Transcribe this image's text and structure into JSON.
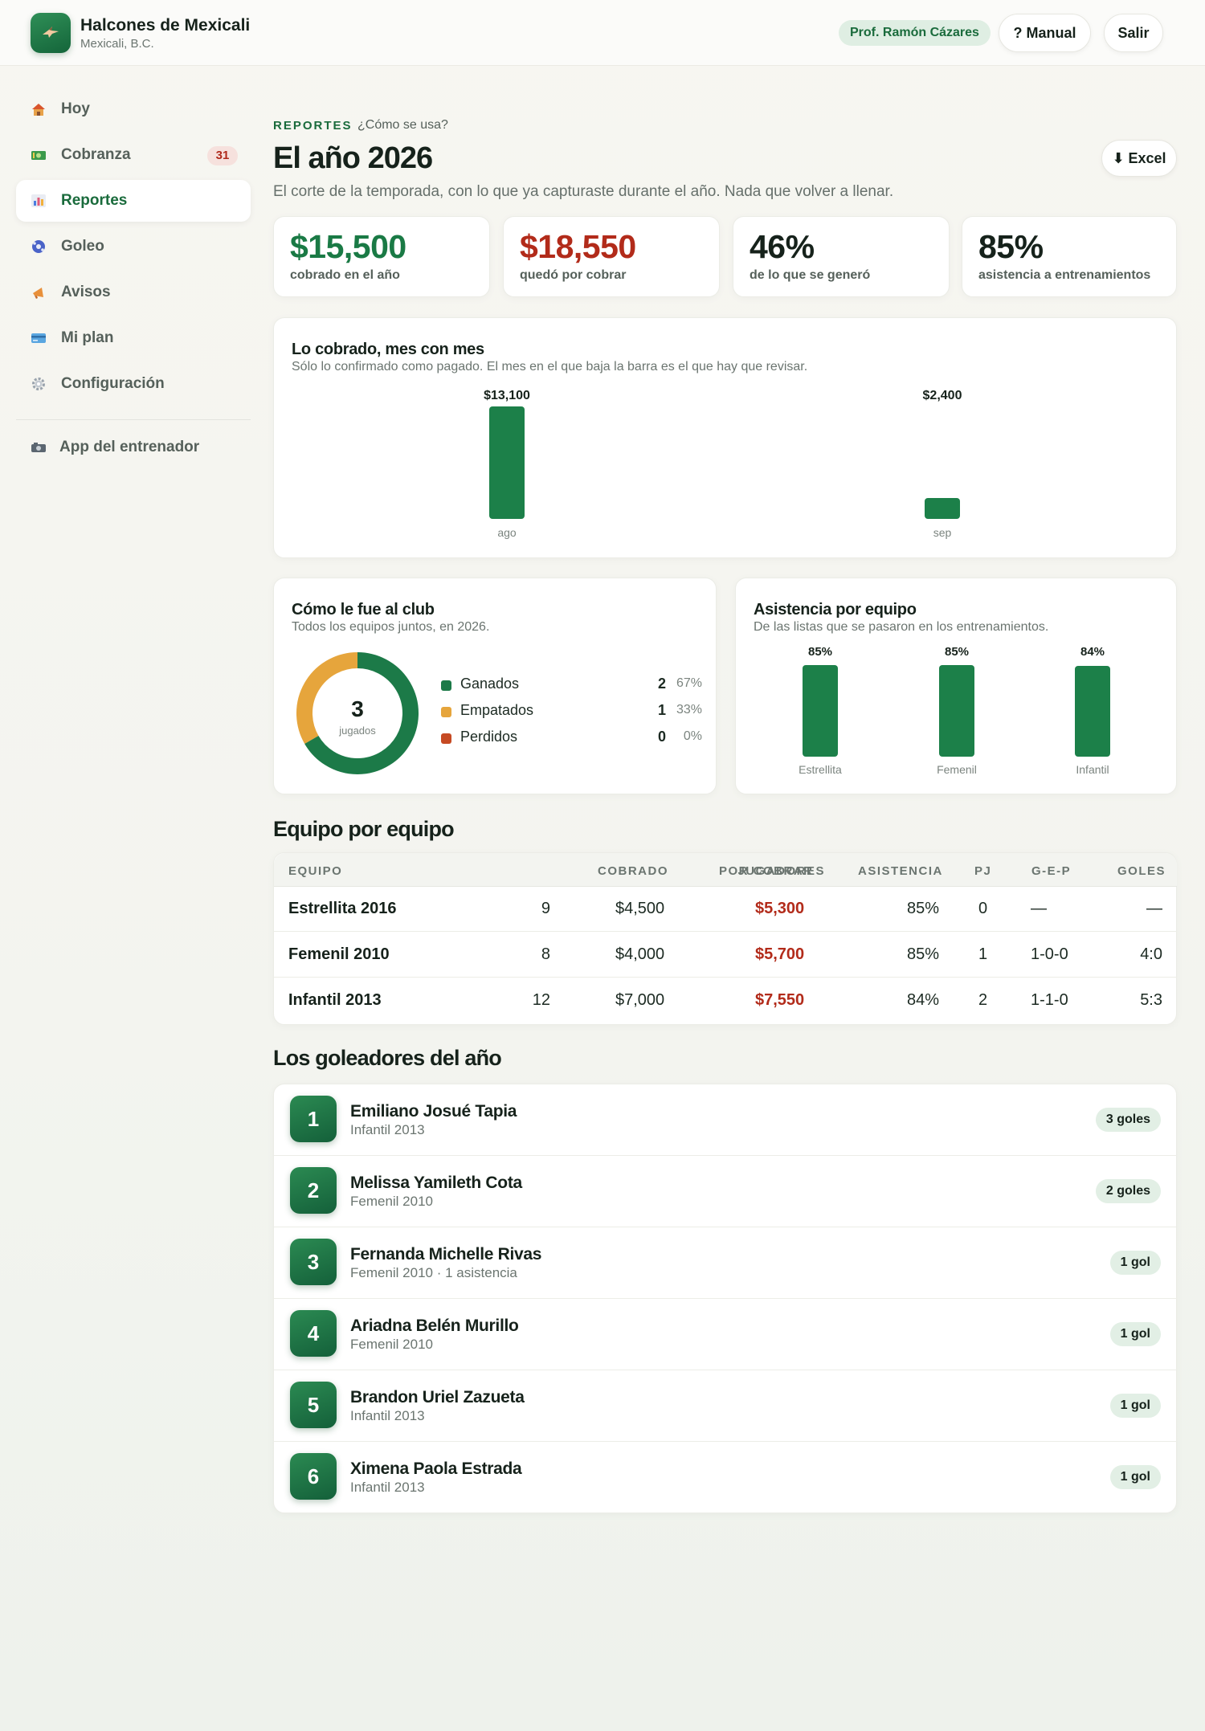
{
  "header": {
    "club_name": "Halcones de Mexicali",
    "club_city": "Mexicali, B.C.",
    "coach": "Prof. Ramón Cázares",
    "manual_label": "? Manual",
    "logout_label": "Salir"
  },
  "sidebar": {
    "items": [
      {
        "label": "Hoy",
        "icon": "house-icon"
      },
      {
        "label": "Cobranza",
        "icon": "money-icon",
        "badge": "31"
      },
      {
        "label": "Reportes",
        "icon": "chart-icon",
        "active": true
      },
      {
        "label": "Goleo",
        "icon": "soccer-ball-icon"
      },
      {
        "label": "Avisos",
        "icon": "megaphone-icon"
      },
      {
        "label": "Mi plan",
        "icon": "credit-card-icon"
      },
      {
        "label": "Configuración",
        "icon": "gear-icon"
      }
    ],
    "coach_app": {
      "label": "App del entrenador",
      "icon": "camera-icon"
    }
  },
  "page": {
    "kicker": "REPORTES",
    "howto": "¿Cómo se usa?",
    "title": "El año 2026",
    "subtitle": "El corte de la temporada, con lo que ya capturaste durante el año. Nada que volver a llenar.",
    "excel_label": "⬇ Excel"
  },
  "kpis": [
    {
      "value": "$15,500",
      "label": "cobrado en el año",
      "color": "#1a7a45"
    },
    {
      "value": "$18,550",
      "label": "quedó por cobrar",
      "color": "#b22b1a"
    },
    {
      "value": "46%",
      "label": "de lo que se generó",
      "color": "#16221b"
    },
    {
      "value": "85%",
      "label": "asistencia a entrenamientos",
      "color": "#16221b"
    }
  ],
  "monthly": {
    "title": "Lo cobrado, mes con mes",
    "subtitle": "Sólo lo confirmado como pagado. El mes en el que baja la barra es el que hay que revisar."
  },
  "club": {
    "title": "Cómo le fue al club",
    "subtitle": "Todos los equipos juntos, en 2026.",
    "center_value": "3",
    "center_label": "jugados",
    "legend": [
      {
        "name": "Ganados",
        "count": "2",
        "pct": "67%",
        "value": 2,
        "color": "#1c7a48"
      },
      {
        "name": "Empatados",
        "count": "1",
        "pct": "33%",
        "value": 1,
        "color": "#e6a53c"
      },
      {
        "name": "Perdidos",
        "count": "0",
        "pct": "0%",
        "value": 0,
        "color": "#c64a23"
      }
    ]
  },
  "attendance": {
    "title": "Asistencia por equipo",
    "subtitle": "De las listas que se pasaron en los entrenamientos."
  },
  "chart_data": [
    {
      "type": "bar",
      "categories": [
        "ago",
        "sep"
      ],
      "values": [
        13100,
        2400
      ],
      "value_labels": [
        "$13,100",
        "$2,400"
      ],
      "ylim": [
        0,
        13100
      ]
    },
    {
      "type": "pie",
      "categories": [
        "Ganados",
        "Empatados",
        "Perdidos"
      ],
      "values": [
        2,
        1,
        0
      ]
    },
    {
      "type": "bar",
      "categories": [
        "Estrellita",
        "Femenil",
        "Infantil"
      ],
      "values": [
        85,
        85,
        84
      ],
      "value_labels": [
        "85%",
        "85%",
        "84%"
      ],
      "ylim": [
        0,
        100
      ]
    }
  ],
  "teams": {
    "title": "Equipo por equipo",
    "headers": [
      "EQUIPO",
      "JUGADORES",
      "COBRADO",
      "POR COBRAR",
      "ASISTENCIA",
      "PJ",
      "G-E-P",
      "GOLES"
    ],
    "rows": [
      [
        "Estrellita 2016",
        "9",
        "$4,500",
        "$5,300",
        "85%",
        "0",
        "—",
        "—"
      ],
      [
        "Femenil 2010",
        "8",
        "$4,000",
        "$5,700",
        "85%",
        "1",
        "1-0-0",
        "4:0"
      ],
      [
        "Infantil 2013",
        "12",
        "$7,000",
        "$7,550",
        "84%",
        "2",
        "1-1-0",
        "5:3"
      ]
    ]
  },
  "scorers": {
    "title": "Los goleadores del año",
    "items": [
      {
        "rank": "1",
        "name": "Emiliano Josué Tapia",
        "team": "Infantil 2013",
        "goals": "3 goles"
      },
      {
        "rank": "2",
        "name": "Melissa Yamileth Cota",
        "team": "Femenil 2010",
        "goals": "2 goles"
      },
      {
        "rank": "3",
        "name": "Fernanda Michelle Rivas",
        "team": "Femenil 2010 · 1 asistencia",
        "goals": "1 gol"
      },
      {
        "rank": "4",
        "name": "Ariadna Belén Murillo",
        "team": "Femenil 2010",
        "goals": "1 gol"
      },
      {
        "rank": "5",
        "name": "Brandon Uriel Zazueta",
        "team": "Infantil 2013",
        "goals": "1 gol"
      },
      {
        "rank": "6",
        "name": "Ximena Paola Estrada",
        "team": "Infantil 2013",
        "goals": "1 gol"
      }
    ]
  }
}
